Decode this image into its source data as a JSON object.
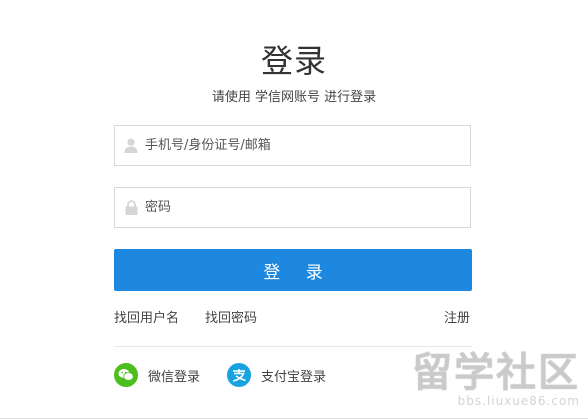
{
  "header": {
    "title": "登录",
    "subtitle": "请使用 学信网账号 进行登录"
  },
  "form": {
    "username_placeholder": "手机号/身份证号/邮箱",
    "username_value": "",
    "password_placeholder": "密码",
    "password_value": "",
    "submit_label": "登 录"
  },
  "links": {
    "forgot_username": "找回用户名",
    "forgot_password": "找回密码",
    "register": "注册"
  },
  "social": {
    "wechat_label": "微信登录",
    "alipay_label": "支付宝登录",
    "wechat_color": "#4cbf1e",
    "alipay_color": "#16a3e0"
  },
  "watermark": {
    "brand": "留学社区",
    "url": "bbs.liuxue86.com"
  },
  "icons": {
    "user": "user-icon",
    "lock": "lock-icon",
    "wechat": "wechat-icon",
    "alipay": "alipay-icon"
  },
  "colors": {
    "primary": "#1e88e0",
    "border": "#d9d9d9"
  }
}
